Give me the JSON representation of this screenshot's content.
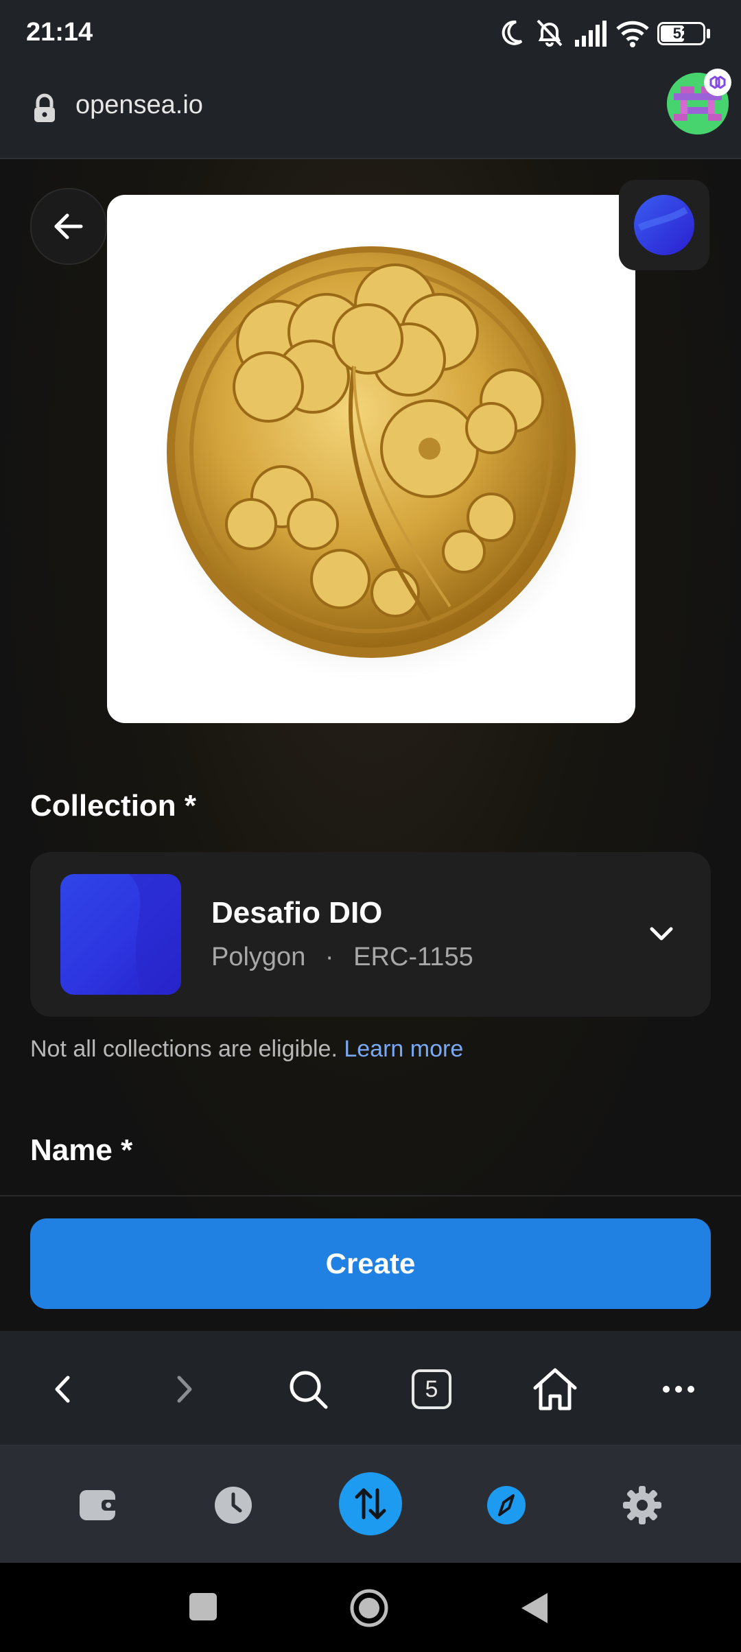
{
  "status_bar": {
    "time": "21:14",
    "battery": "52",
    "icons": [
      "moon-icon",
      "bell-off-icon",
      "signal-icon",
      "wifi-icon",
      "battery-icon"
    ]
  },
  "url_bar": {
    "url": "opensea.io",
    "icons": [
      "lock-icon",
      "profile-avatar"
    ]
  },
  "page": {
    "back_icon": "arrow-left-icon",
    "image_alt": "gold-coin-clover",
    "collection": {
      "label": "Collection *",
      "name": "Desafio DIO",
      "chain": "Polygon",
      "separator": "·",
      "standard": "ERC-1155"
    },
    "eligibility_note": "Not all collections are eligible.",
    "learn_more": "Learn more",
    "name_label": "Name *",
    "create_button": "Create"
  },
  "browser_toolbar": {
    "tab_count": "5",
    "icons": [
      "chevron-left-icon",
      "chevron-right-icon",
      "search-icon",
      "tabs-icon",
      "home-icon",
      "more-icon"
    ]
  },
  "dock": {
    "icons": [
      "wallet-icon",
      "clock-icon",
      "swap-icon",
      "compass-icon",
      "gear-icon"
    ],
    "accent": "#1d9bf0"
  },
  "system_nav": {
    "icons": [
      "square-icon",
      "circle-icon",
      "triangle-back-icon"
    ]
  },
  "colors": {
    "primary": "#2081e2",
    "link": "#7aa9f5",
    "background": "#121212"
  }
}
